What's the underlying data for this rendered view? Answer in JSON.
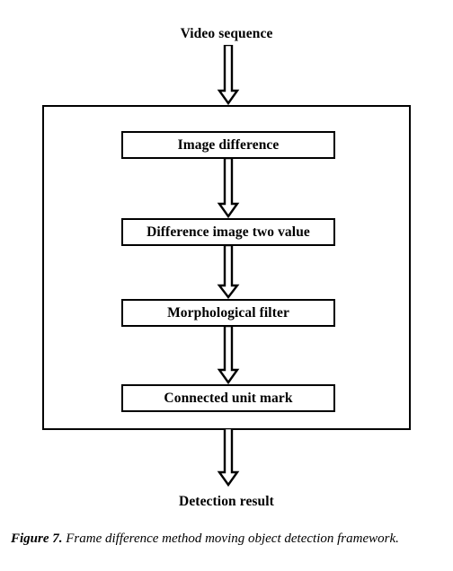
{
  "figure": {
    "input_label": "Video sequence",
    "output_label": "Detection result",
    "steps": [
      {
        "label": "Image difference"
      },
      {
        "label": "Difference image two value"
      },
      {
        "label": "Morphological filter"
      },
      {
        "label": "Connected unit mark"
      }
    ],
    "arrows": [
      {
        "name": "arrow-input-to-container",
        "direction": "down"
      },
      {
        "name": "arrow-step0-to-step1",
        "direction": "down"
      },
      {
        "name": "arrow-step1-to-step2",
        "direction": "down"
      },
      {
        "name": "arrow-step2-to-step3",
        "direction": "down"
      },
      {
        "name": "arrow-step3-to-output",
        "direction": "down"
      }
    ],
    "colors": {
      "stroke": "#000000",
      "fill": "#ffffff",
      "background": "#ffffff"
    }
  },
  "caption": {
    "number": "Figure 7.",
    "text": "Frame difference method moving object detection framework."
  }
}
